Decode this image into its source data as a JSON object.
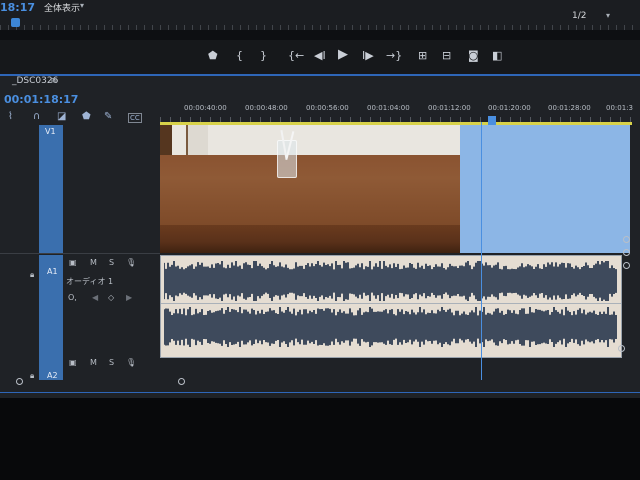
{
  "monitor": {
    "timecode": "18:17",
    "fit": "全体表示",
    "resolution": "1/2"
  },
  "transport": {
    "marker_icon": "marker-icon",
    "in_label": "{",
    "out_label": "}",
    "go_in_icon": "go-to-in-icon",
    "step_back_icon": "step-back-icon",
    "play_icon": "play-icon",
    "step_fwd_icon": "step-forward-icon",
    "go_out_icon": "go-to-out-icon",
    "insert_icon": "insert-icon",
    "overwrite_icon": "overwrite-icon",
    "camera_icon": "camera-icon",
    "compare_icon": "compare-icon"
  },
  "timeline": {
    "sequence_name": "_DSC0326",
    "menu_glyph": "≡",
    "timecode": "00:01:18:17",
    "ruler_ticks": [
      "00:00:40:00",
      "00:00:48:00",
      "00:00:56:00",
      "00:01:04:00",
      "00:01:12:00",
      "00:01:20:00",
      "00:01:28:00",
      "00:01:3"
    ],
    "tracks": {
      "v1": "V1",
      "a1": "A1",
      "a2": "A2",
      "audio_name": "オーディオ 1",
      "m": "M",
      "s": "S",
      "m2": "M",
      "s2": "S"
    },
    "playhead_fraction": 0.68
  },
  "colors": {
    "accent": "#4a8fe0",
    "video_fill": "#8cb6e6",
    "audio_bg": "#e5ddd2",
    "waveform": "#3e4a5c"
  },
  "icons": {
    "snap": "snap-icon",
    "linked": "linked-selection-icon",
    "add_marker": "add-marker-icon",
    "settings": "wrench-icon",
    "captions": "captions-icon",
    "lock": "lock-icon",
    "mic": "microphone-icon",
    "camera_small": "track-camera-icon"
  }
}
